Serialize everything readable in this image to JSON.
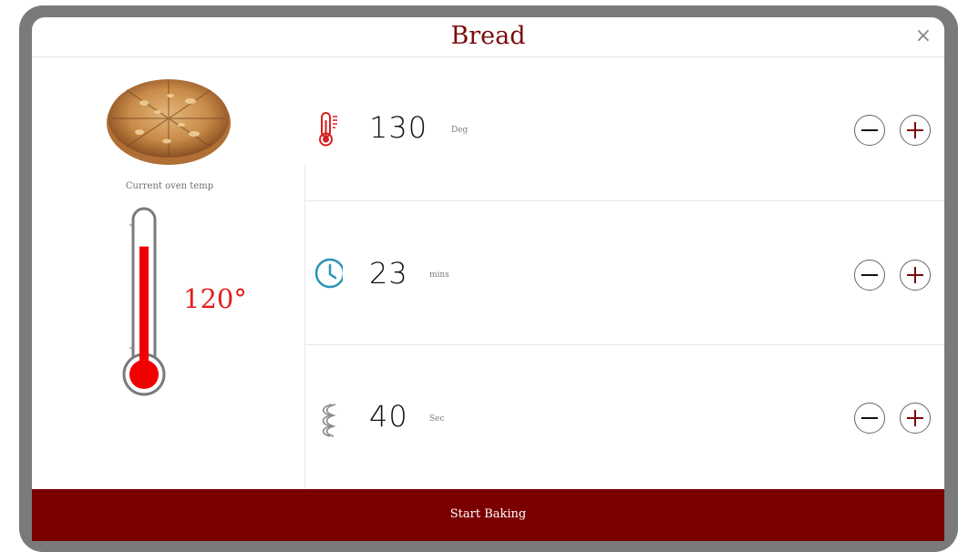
{
  "dialog": {
    "title": "Bread",
    "close_icon": "×"
  },
  "oven": {
    "label": "Current oven temp",
    "temperature": "120°",
    "level": 0.8
  },
  "settings": [
    {
      "icon": "thermometer-icon",
      "value": "130",
      "unit": "Deg",
      "color": "#d61f1f"
    },
    {
      "icon": "clock-icon",
      "value": "23",
      "unit": "mins",
      "color": "#2a93b8"
    },
    {
      "icon": "steam-icon",
      "value": "40",
      "unit": "Sec",
      "color": "#8a8a8a"
    }
  ],
  "actions": {
    "start_label": "Start Baking"
  },
  "colors": {
    "brand": "#7a0000",
    "temperature": "#e41e1e"
  }
}
